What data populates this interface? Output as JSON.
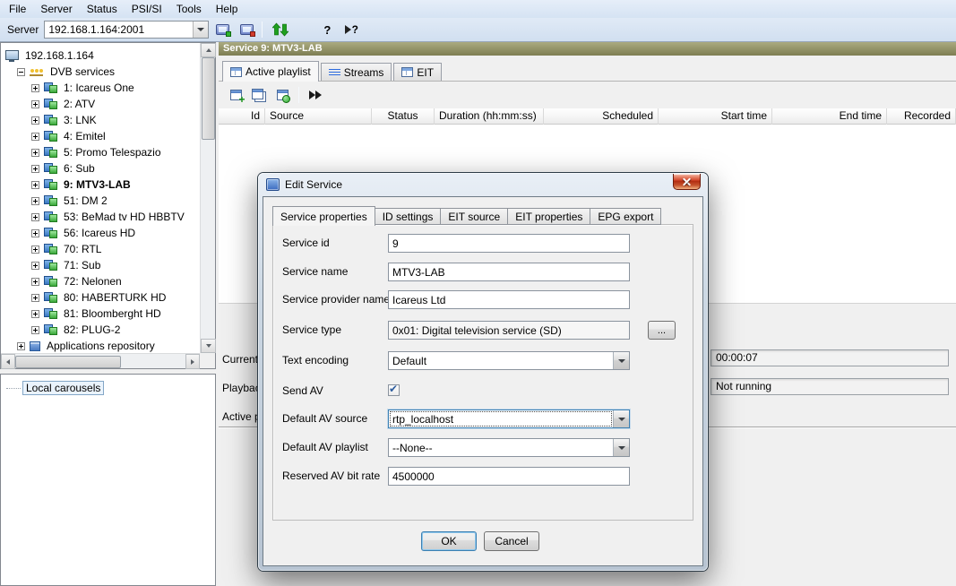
{
  "menubar": {
    "items": [
      "File",
      "Server",
      "Status",
      "PSI/SI",
      "Tools",
      "Help"
    ]
  },
  "toolbar": {
    "server_label": "Server",
    "server_address": "192.168.1.164:2001",
    "help_glyph": "?"
  },
  "tree": {
    "root": "192.168.1.164",
    "dvb_group": "DVB services",
    "apps_group": "Applications repository",
    "services": [
      "1: Icareus One",
      "2: ATV",
      "3: LNK",
      "4: Emitel",
      "5: Promo Telespazio",
      "6: Sub",
      "9: MTV3-LAB",
      "51: DM 2",
      "53: BeMad tv HD HBBTV",
      "56: Icareus HD",
      "70: RTL",
      "71: Sub",
      "72: Nelonen",
      "80: HABERTURK HD",
      "81: Bloomberght HD",
      "82: PLUG-2"
    ],
    "selected_service": "9: MTV3-LAB",
    "local_carousels": "Local carousels"
  },
  "service_panel": {
    "header": "Service 9: MTV3-LAB",
    "tabs": [
      "Active playlist",
      "Streams",
      "EIT"
    ],
    "columns": [
      "Id",
      "Source",
      "Status",
      "Duration (hh:mm:ss)",
      "Scheduled",
      "Start time",
      "End time",
      "Recorded"
    ],
    "status": {
      "current_label": "Current",
      "current_value": "00:00:07",
      "playback_label": "Playbac",
      "playback_value": "Not running",
      "active_label": "Active p"
    }
  },
  "dialog": {
    "title": "Edit Service",
    "tabs": [
      "Service properties",
      "ID settings",
      "EIT source",
      "EIT properties",
      "EPG export"
    ],
    "active_tab": "Service properties",
    "fields": {
      "service_id": {
        "label": "Service id",
        "value": "9"
      },
      "service_name": {
        "label": "Service name",
        "value": "MTV3-LAB"
      },
      "provider_name": {
        "label": "Service provider name",
        "value": "Icareus Ltd"
      },
      "service_type": {
        "label": "Service type",
        "value": "0x01: Digital television service (SD)",
        "browse_label": "..."
      },
      "text_encoding": {
        "label": "Text encoding",
        "value": "Default"
      },
      "send_av": {
        "label": "Send AV",
        "checked": true
      },
      "av_source": {
        "label": "Default AV source",
        "value": "rtp_localhost"
      },
      "av_playlist": {
        "label": "Default AV playlist",
        "value": "--None--"
      },
      "bit_rate": {
        "label": "Reserved AV bit rate",
        "value": "4500000"
      }
    },
    "buttons": {
      "ok": "OK",
      "cancel": "Cancel"
    }
  },
  "colors": {
    "service_header_top": "#aaaa80",
    "service_header_bottom": "#7d7d52",
    "focus_blue": "#3c7fb1",
    "close_button_red": "#b02a10",
    "menubar_blue": "#d5e3f3"
  }
}
